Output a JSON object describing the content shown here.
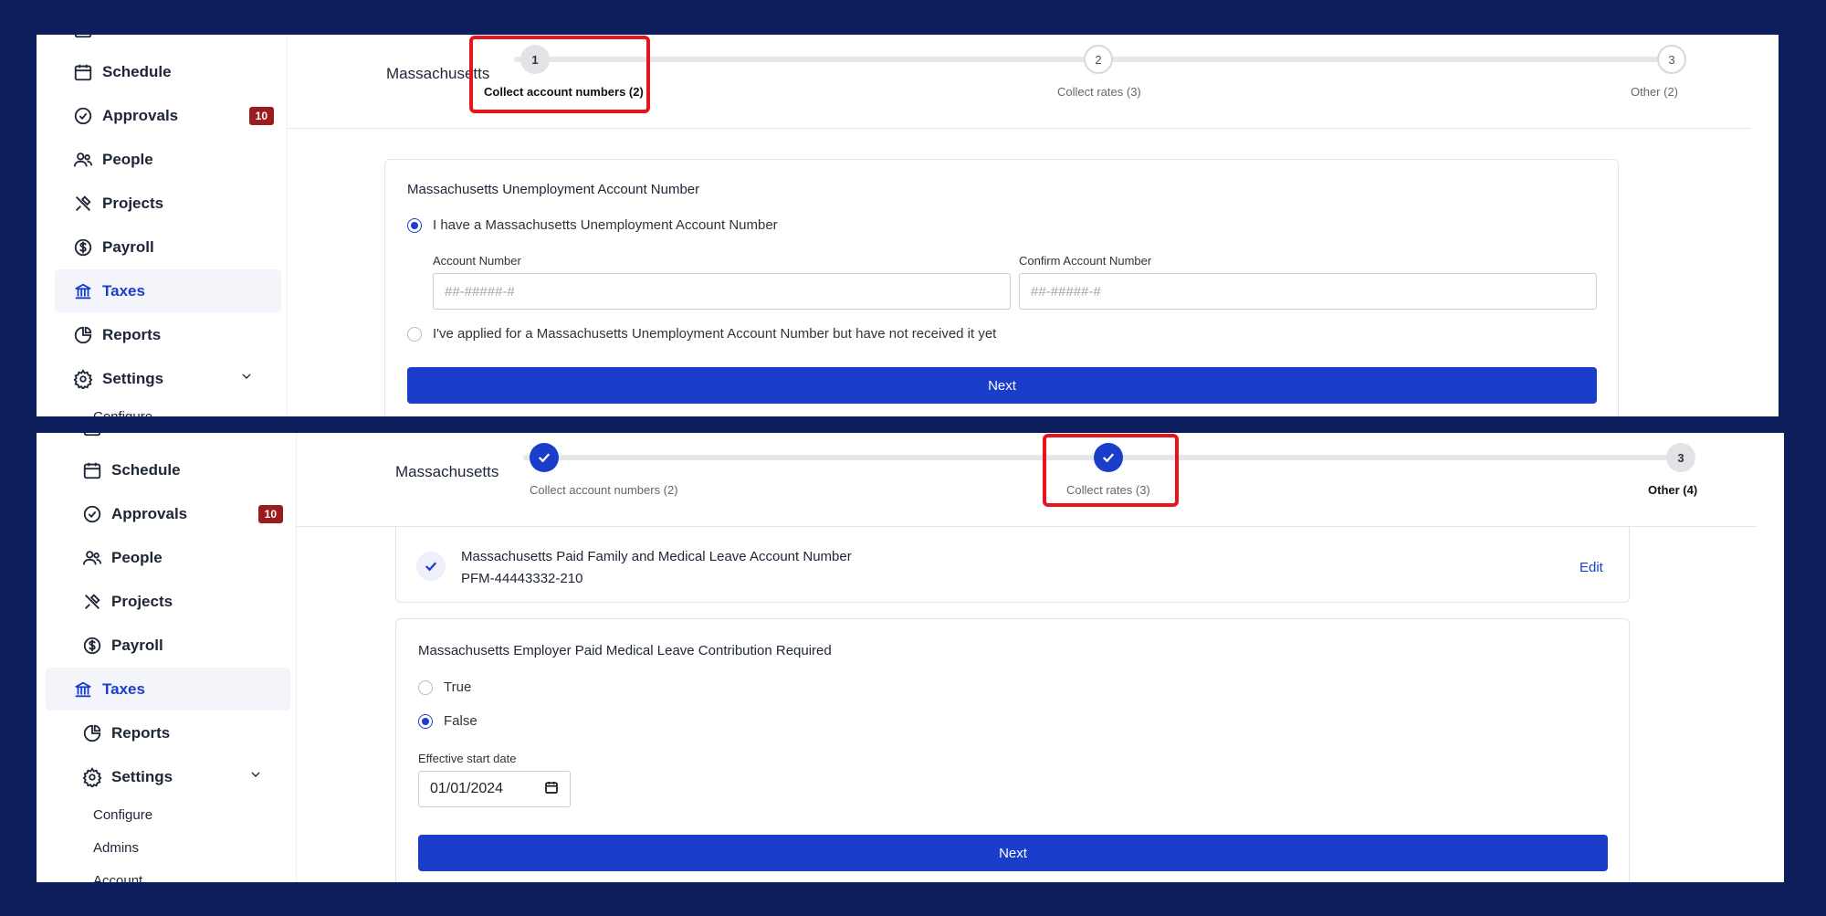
{
  "colors": {
    "frame": "#0c1e5b",
    "accent": "#1a3ec9",
    "highlight": "#e8141b",
    "badge": "#9b1c1c"
  },
  "sidebar": {
    "items": [
      {
        "label": "Schedule",
        "icon": "calendar-icon"
      },
      {
        "label": "Approvals",
        "icon": "check-circle-icon",
        "badge": "10"
      },
      {
        "label": "People",
        "icon": "people-icon"
      },
      {
        "label": "Projects",
        "icon": "tools-icon"
      },
      {
        "label": "Payroll",
        "icon": "dollar-icon"
      },
      {
        "label": "Taxes",
        "icon": "bank-icon",
        "active": true
      },
      {
        "label": "Reports",
        "icon": "pie-chart-icon"
      },
      {
        "label": "Settings",
        "icon": "gear-icon",
        "expandable": true
      }
    ],
    "settings_subitems": [
      "Configure",
      "Admins",
      "Account"
    ]
  },
  "top": {
    "state_title": "Massachusetts",
    "steps": [
      {
        "number": "1",
        "label": "Collect account numbers (2)"
      },
      {
        "number": "2",
        "label": "Collect rates (3)"
      },
      {
        "number": "3",
        "label": "Other (2)"
      }
    ],
    "card": {
      "title": "Massachusetts Unemployment Account Number",
      "option_have": "I have a Massachusetts Unemployment Account Number",
      "account_label": "Account Number",
      "account_placeholder": "##-#####-#",
      "confirm_label": "Confirm Account Number",
      "confirm_placeholder": "##-#####-#",
      "option_applied": "I've applied for a Massachusetts Unemployment Account Number but have not received it yet",
      "next_label": "Next"
    }
  },
  "bottom": {
    "state_title": "Massachusetts",
    "steps": [
      {
        "label": "Collect account numbers (2)"
      },
      {
        "label": "Collect rates (3)"
      },
      {
        "number": "3",
        "label": "Other (4)"
      }
    ],
    "pfml": {
      "title": "Massachusetts Paid Family and Medical Leave Account Number",
      "value": "PFM-44443332-210",
      "edit_label": "Edit"
    },
    "card": {
      "title": "Massachusetts Employer Paid Medical Leave Contribution Required",
      "option_true": "True",
      "option_false": "False",
      "date_label": "Effective start date",
      "date_value": "01/01/2024",
      "next_label": "Next"
    }
  }
}
